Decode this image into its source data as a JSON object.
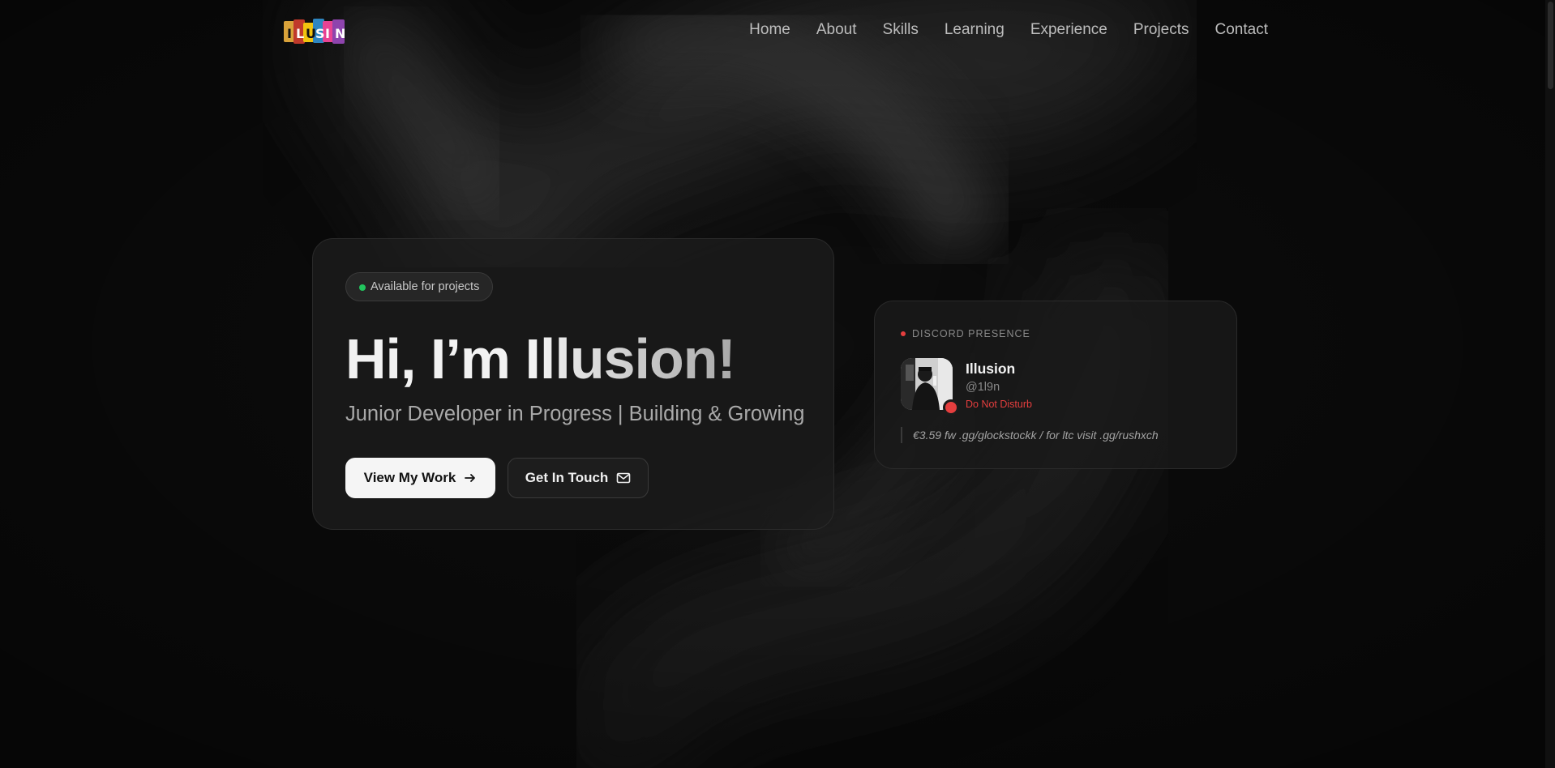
{
  "nav": {
    "logo_icon": "illusion-sticker-logo",
    "links": [
      "Home",
      "About",
      "Skills",
      "Learning",
      "Experience",
      "Projects",
      "Contact"
    ]
  },
  "hero": {
    "badge": "Available for projects",
    "title_greeting": "Hi, I’m ",
    "title_name": "Illusion!",
    "subtitle": "Junior Developer in Progress | Building & Growing",
    "primary_button": "View My Work",
    "primary_icon": "arrow-right-icon",
    "secondary_button": "Get In Touch",
    "secondary_icon": "mail-icon"
  },
  "discord": {
    "heading": "DISCORD PRESENCE",
    "display_name": "Illusion",
    "handle": "@1l9n",
    "status": "Do Not Disturb",
    "activity": "€3.59 fw .gg/glockstockk / for ltc visit .gg/rushxch"
  },
  "colors": {
    "background": "#0d0d0d",
    "available_dot": "#22c55e",
    "dnd_red": "#e53e3e"
  }
}
